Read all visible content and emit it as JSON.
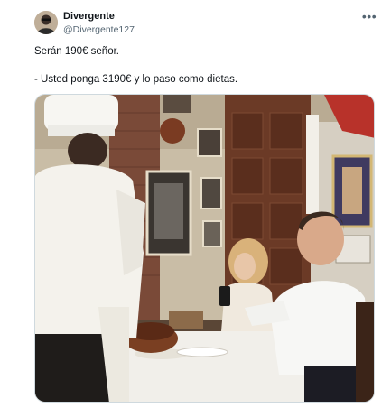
{
  "tweet": {
    "author_name": "Divergente",
    "author_handle": "@Divergente127",
    "more_icon": "more-horizontal-icon",
    "line1": "Serán 190€ señor.",
    "line2": "- Usted ponga 3190€ y lo paso como dietas."
  },
  "colors": {
    "text_primary": "#0f1419",
    "text_secondary": "#536471",
    "border": "#cfd9de"
  }
}
